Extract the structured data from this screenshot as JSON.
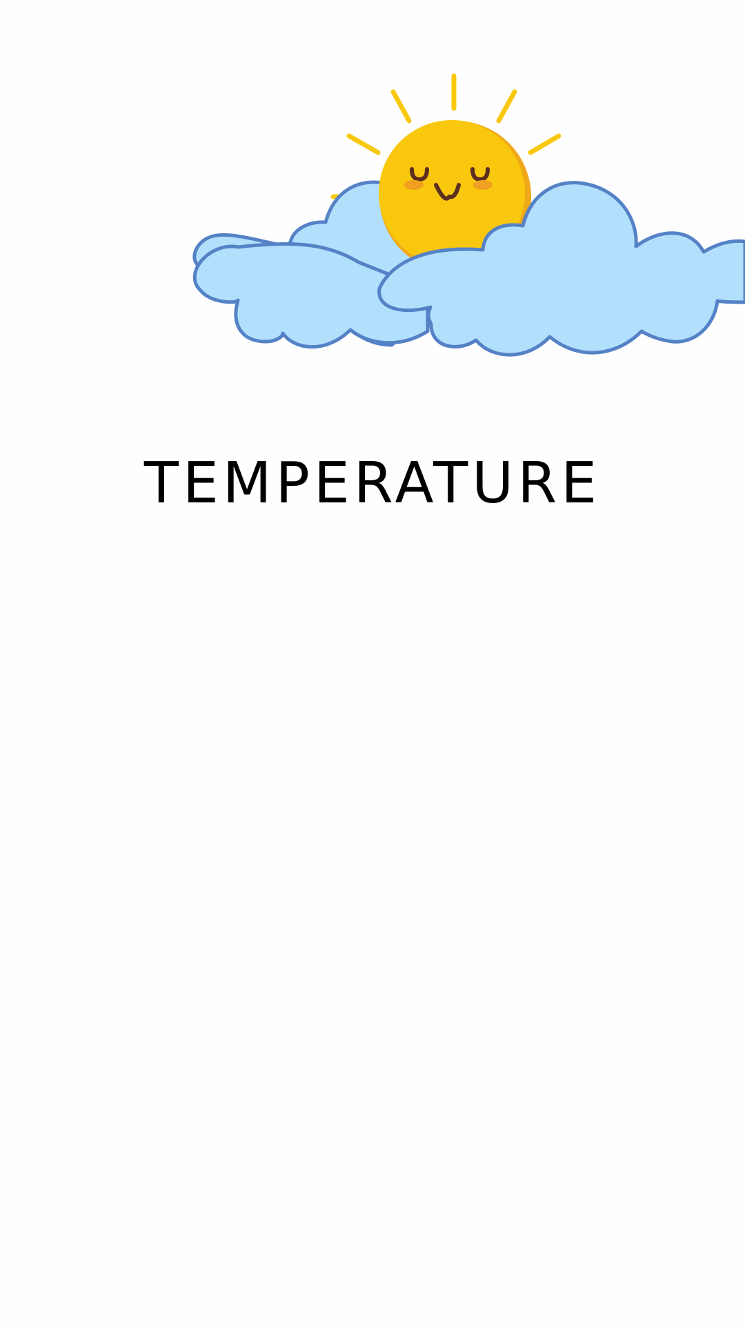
{
  "screen": {
    "title": "TEMPERATURE"
  },
  "illustration": {
    "icons": [
      "sun-icon",
      "cloud-icon"
    ],
    "colors": {
      "sun": "#f9c80e",
      "sun_shadow": "#f0a81a",
      "cloud_fill": "#b2e0fc",
      "cloud_outline": "#5582c6",
      "face": "#5c2e1f",
      "cheek": "#f0a020",
      "background": "#fefefe"
    }
  }
}
